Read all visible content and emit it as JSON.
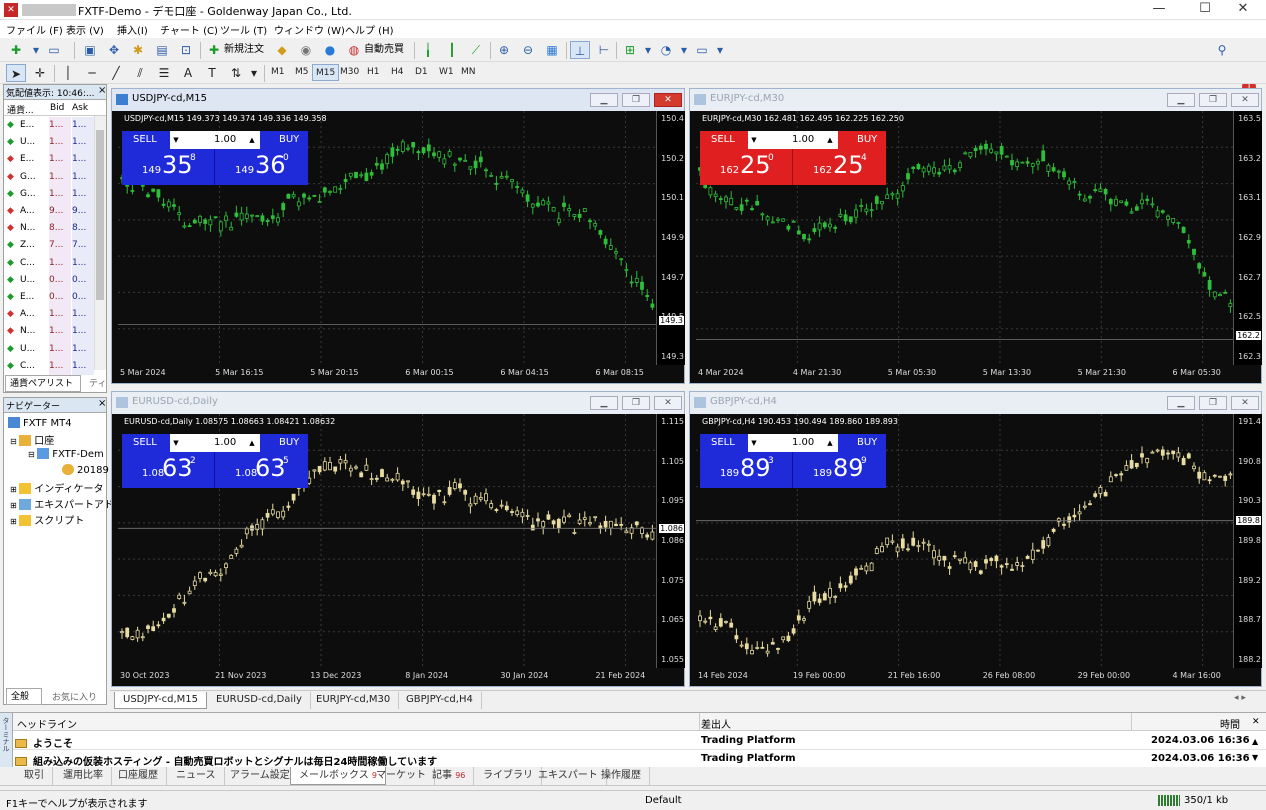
{
  "window": {
    "title": "FXTF-Demo - デモ口座 - Goldenway Japan Co., Ltd.",
    "min": "—",
    "max": "☐",
    "close": "✕"
  },
  "menu": [
    "ファイル (F)",
    "表示 (V)",
    "挿入(I)",
    "チャート (C)",
    "ツール (T)",
    "ウィンドウ (W)",
    "ヘルプ (H)"
  ],
  "toolbar": {
    "new_order": "新規注文",
    "auto_trade": "自動売買",
    "notify_count": "1"
  },
  "periods": [
    "M1",
    "M5",
    "M15",
    "M30",
    "H1",
    "H4",
    "D1",
    "W1",
    "MN"
  ],
  "active_period": "M15",
  "market_watch": {
    "title": "気配値表示: 10:46:...",
    "col_symbol": "通貨...",
    "col_bid": "Bid",
    "col_ask": "Ask",
    "rows": [
      {
        "dir": "up",
        "sym": "E...",
        "bid": "1...",
        "ask": "1..."
      },
      {
        "dir": "up",
        "sym": "U...",
        "bid": "1...",
        "ask": "1..."
      },
      {
        "dir": "down",
        "sym": "E...",
        "bid": "1...",
        "ask": "1..."
      },
      {
        "dir": "down",
        "sym": "G...",
        "bid": "1...",
        "ask": "1..."
      },
      {
        "dir": "up",
        "sym": "G...",
        "bid": "1...",
        "ask": "1..."
      },
      {
        "dir": "down",
        "sym": "A...",
        "bid": "9...",
        "ask": "9..."
      },
      {
        "dir": "down",
        "sym": "N...",
        "bid": "8...",
        "ask": "8..."
      },
      {
        "dir": "up",
        "sym": "Z...",
        "bid": "7...",
        "ask": "7..."
      },
      {
        "dir": "up",
        "sym": "C...",
        "bid": "1...",
        "ask": "1..."
      },
      {
        "dir": "up",
        "sym": "U...",
        "bid": "0...",
        "ask": "0..."
      },
      {
        "dir": "up",
        "sym": "E...",
        "bid": "0...",
        "ask": "0..."
      },
      {
        "dir": "down",
        "sym": "A...",
        "bid": "1...",
        "ask": "1..."
      },
      {
        "dir": "down",
        "sym": "N...",
        "bid": "1...",
        "ask": "1..."
      },
      {
        "dir": "up",
        "sym": "U...",
        "bid": "1...",
        "ask": "1..."
      },
      {
        "dir": "up",
        "sym": "C...",
        "bid": "1...",
        "ask": "1..."
      }
    ],
    "tabs": [
      "通貨ペアリスト",
      "ティ"
    ]
  },
  "navigator": {
    "title": "ナビゲーター",
    "root": "FXTF MT4",
    "account_group": "口座",
    "server": "FXTF-Dem",
    "account": "20189",
    "indicators": "インディケータ",
    "experts": "エキスパートアド",
    "scripts": "スクリプト",
    "tabs": [
      "全般",
      "お気に入り"
    ]
  },
  "charts": [
    {
      "title": "USDJPY-cd,M15",
      "ohlc": "USDJPY-cd,M15  149.373 149.374 149.336 149.358",
      "active": true,
      "color": "#2fbf3a",
      "sell_lbl": "SELL",
      "buy_lbl": "BUY",
      "lot": "1.00",
      "panel_color": "#1f2bd8",
      "panel_dark": "#1010a0",
      "bid_big": "149",
      "bid_mid": "35",
      "bid_sup": "8",
      "ask_big": "149",
      "ask_mid": "36",
      "ask_sup": "0",
      "prices": [
        "150.4",
        "150.2",
        "150.1",
        "149.9",
        "149.7",
        "149.5",
        "149.3"
      ],
      "current": "149.3",
      "times": [
        "5 Mar 2024",
        "5 Mar 16:15",
        "5 Mar 20:15",
        "6 Mar 00:15",
        "6 Mar 04:15",
        "6 Mar 08:15"
      ],
      "seed": 11,
      "trend": "down",
      "hlevel": 0.84
    },
    {
      "title": "EURJPY-cd,M30",
      "ohlc": "EURJPY-cd,M30  162.481 162.495 162.225 162.250",
      "active": false,
      "color": "#2fbf3a",
      "sell_lbl": "SELL",
      "buy_lbl": "BUY",
      "lot": "1.00",
      "panel_color": "#e02020",
      "panel_dark": "#a01010",
      "bid_big": "162",
      "bid_mid": "25",
      "bid_sup": "0",
      "ask_big": "162",
      "ask_mid": "25",
      "ask_sup": "4",
      "prices": [
        "163.5",
        "163.2",
        "163.1",
        "162.9",
        "162.7",
        "162.5",
        "162.3"
      ],
      "current": "162.2",
      "times": [
        "4 Mar 2024",
        "4 Mar 21:30",
        "5 Mar 05:30",
        "5 Mar 13:30",
        "5 Mar 21:30",
        "6 Mar 05:30"
      ],
      "seed": 23,
      "trend": "down",
      "hlevel": 0.9
    },
    {
      "title": "EURUSD-cd,Daily",
      "ohlc": "EURUSD-cd,Daily  1.08575 1.08663 1.08421 1.08632",
      "active": false,
      "color": "#e8dca0",
      "sell_lbl": "SELL",
      "buy_lbl": "BUY",
      "lot": "1.00",
      "panel_color": "#1f2bd8",
      "panel_dark": "#1010a0",
      "bid_big": "1.08",
      "bid_mid": "63",
      "bid_sup": "2",
      "ask_big": "1.08",
      "ask_mid": "63",
      "ask_sup": "5",
      "prices": [
        "1.115",
        "1.105",
        "1.095",
        "1.086",
        "1.075",
        "1.065",
        "1.055"
      ],
      "current": "1.086",
      "times": [
        "30 Oct 2023",
        "21 Nov 2023",
        "13 Dec 2023",
        "8 Jan 2024",
        "30 Jan 2024",
        "21 Feb 2024"
      ],
      "seed": 37,
      "trend": "hump",
      "hlevel": 0.45
    },
    {
      "title": "GBPJPY-cd,H4",
      "ohlc": "GBPJPY-cd,H4  190.453 190.494 189.860 189.893",
      "active": false,
      "color": "#e8dca0",
      "sell_lbl": "SELL",
      "buy_lbl": "BUY",
      "lot": "1.00",
      "panel_color": "#1f2bd8",
      "panel_dark": "#1010a0",
      "bid_big": "189",
      "bid_mid": "89",
      "bid_sup": "3",
      "ask_big": "189",
      "ask_mid": "89",
      "ask_sup": "9",
      "prices": [
        "191.4",
        "190.8",
        "190.3",
        "189.8",
        "189.2",
        "188.7",
        "188.2"
      ],
      "current": "189.8",
      "times": [
        "14 Feb 2024",
        "19 Feb 00:00",
        "21 Feb 16:00",
        "26 Feb 08:00",
        "29 Feb 00:00",
        "4 Mar 16:00"
      ],
      "seed": 51,
      "trend": "up",
      "hlevel": 0.42
    }
  ],
  "chart_tabs": [
    "USDJPY-cd,M15",
    "EURUSD-cd,Daily",
    "EURJPY-cd,M30",
    "GBPJPY-cd,H4"
  ],
  "terminal": {
    "col_headline": "ヘッドライン",
    "col_from": "差出人",
    "col_time": "時間",
    "side_label": "ターミナル",
    "rows": [
      {
        "headline": "ようこそ",
        "from": "Trading Platform",
        "time": "2024.03.06 16:36"
      },
      {
        "headline": "組み込みの仮装ホスティング - 自動売買ロボットとシグナルは毎日24時間稼働しています",
        "from": "Trading Platform",
        "time": "2024.03.06 16:36"
      }
    ],
    "tabs": [
      {
        "label": "取引",
        "badge": ""
      },
      {
        "label": "運用比率",
        "badge": ""
      },
      {
        "label": "口座履歴",
        "badge": ""
      },
      {
        "label": "ニュース",
        "badge": ""
      },
      {
        "label": "アラーム設定",
        "badge": ""
      },
      {
        "label": "メールボックス",
        "badge": "9"
      },
      {
        "label": "マーケット",
        "badge": ""
      },
      {
        "label": "記事",
        "badge": "96"
      },
      {
        "label": "ライブラリ",
        "badge": ""
      },
      {
        "label": "エキスパート",
        "badge": ""
      },
      {
        "label": "操作履歴",
        "badge": ""
      }
    ],
    "active_tab": 5
  },
  "status": {
    "help": "F1キーでヘルプが表示されます",
    "profile": "Default",
    "traffic": "350/1 kb"
  }
}
